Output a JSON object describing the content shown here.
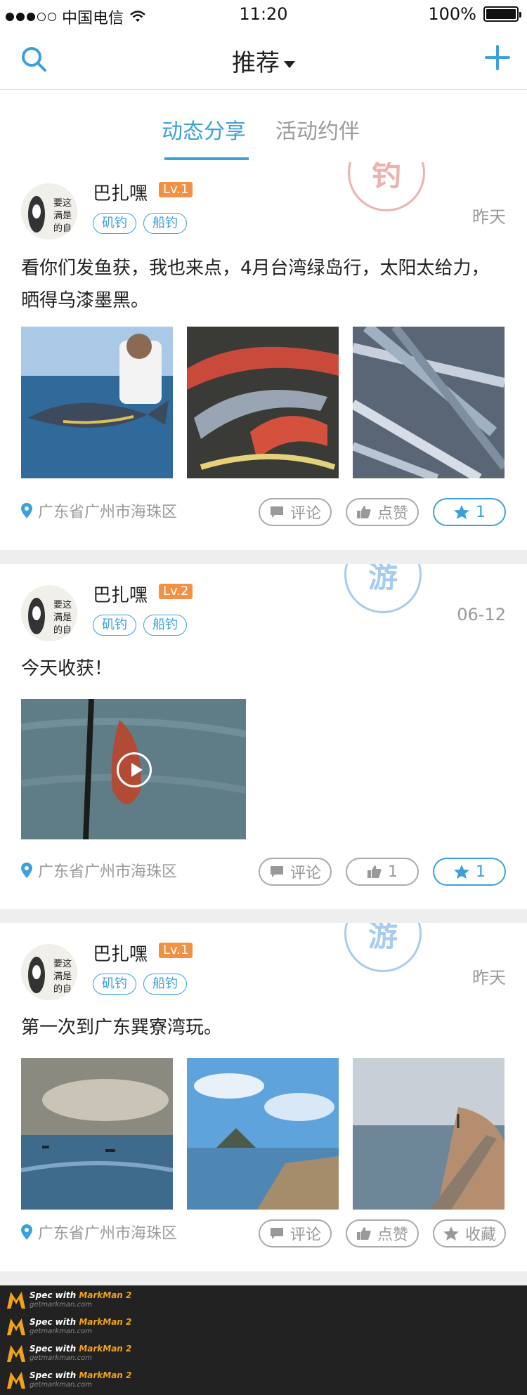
{
  "status_bar": {
    "carrier": "中国电信",
    "time": "11:20",
    "battery": "100%"
  },
  "nav": {
    "title": "推荐",
    "icons": {
      "left": "search-icon",
      "right": "plus-icon"
    }
  },
  "tabs": [
    {
      "label": "动态分享",
      "active": true
    },
    {
      "label": "活动约伴",
      "active": false
    }
  ],
  "posts": [
    {
      "user": "巴扎嘿",
      "level": "Lv.1",
      "tags": [
        "矶钓",
        "船钓"
      ],
      "date": "昨天",
      "stamp": "钓",
      "content": "看你们发鱼获，我也来点，4月台湾绿岛行，太阳太给力，晒得乌漆墨黑。",
      "location": "广东省广州市海珠区",
      "actions": {
        "comment": "评论",
        "like": "点赞",
        "fav_count": "1"
      }
    },
    {
      "user": "巴扎嘿",
      "level": "Lv.2",
      "tags": [
        "矶钓",
        "船钓"
      ],
      "date": "06-12",
      "stamp": "游",
      "content": "今天收获！",
      "location": "广东省广州市海珠区",
      "actions": {
        "comment": "评论",
        "like_count": "1",
        "fav_count": "1"
      }
    },
    {
      "user": "巴扎嘿",
      "level": "Lv.1",
      "tags": [
        "矶钓",
        "船钓"
      ],
      "date": "昨天",
      "stamp": "游",
      "content": "第一次到广东巽寮湾玩。",
      "location": "广东省广州市海珠区",
      "actions": {
        "comment": "评论",
        "like": "点赞",
        "fav": "收藏"
      }
    }
  ],
  "footer": {
    "spec_label": "Spec with",
    "brand": "MarkMan 2",
    "site": "getmarkman.com"
  },
  "colors": {
    "accent": "#3ca0dc",
    "level_badge": "#f19141",
    "separator": "#eeeeee"
  }
}
